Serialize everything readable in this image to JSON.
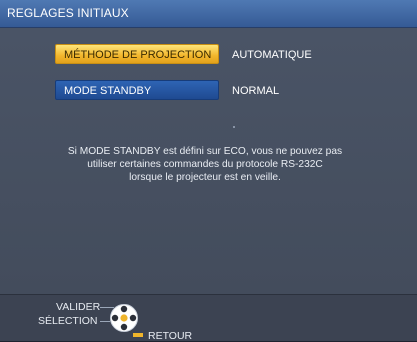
{
  "menu": {
    "title": "REGLAGES INITIAUX",
    "rows": [
      {
        "label": "MÉTHODE DE PROJECTION",
        "value": "AUTOMATIQUE"
      },
      {
        "label": "MODE STANDBY",
        "value": "NORMAL"
      }
    ],
    "note_lines": [
      "Si MODE STANDBY est défini sur ECO, vous ne pouvez pas",
      "utiliser certaines commandes du protocole RS-232C",
      "lorsque le projecteur est en veille."
    ]
  },
  "footer": {
    "valider": "VALIDER",
    "selection": "SÉLECTION",
    "retour": "RETOUR"
  },
  "colors": {
    "selected": "#f2b62c",
    "normal_button": "#2e64b4",
    "title_bar": "#4a74b0",
    "background": "#4a5465"
  },
  "icons": {
    "navigation": "directional-pad-icon",
    "return": "return-key-icon"
  }
}
